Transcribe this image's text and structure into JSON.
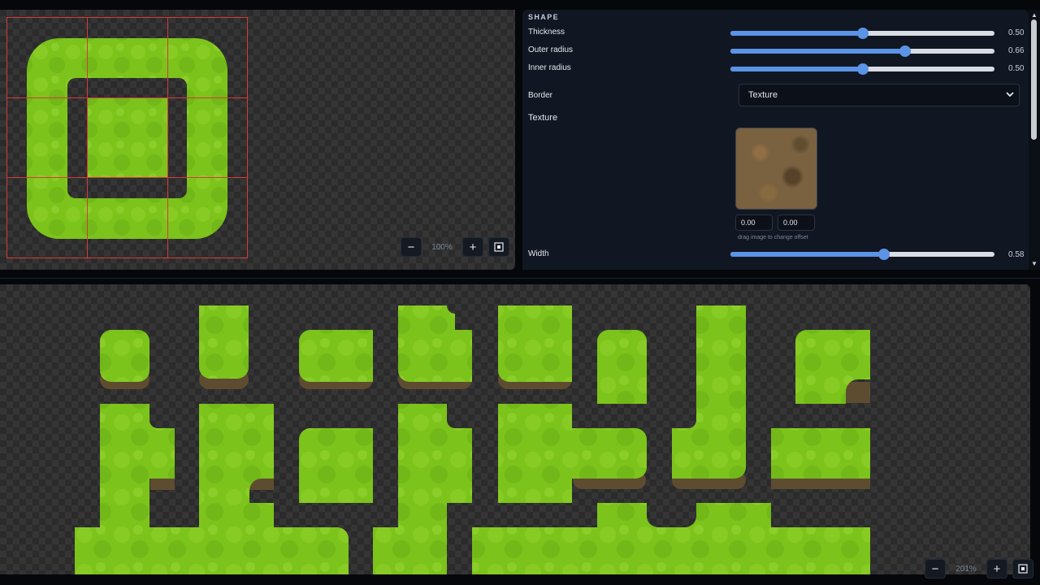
{
  "shape_panel": {
    "section_title": "SHAPE",
    "thickness": {
      "label": "Thickness",
      "value": 0.5,
      "value_text": "0.50"
    },
    "outer_radius": {
      "label": "Outer radius",
      "value": 0.66,
      "value_text": "0.66"
    },
    "inner_radius": {
      "label": "Inner radius",
      "value": 0.5,
      "value_text": "0.50"
    },
    "border": {
      "label": "Border",
      "selected": "Texture"
    },
    "texture": {
      "label": "Texture",
      "offset_x": "0.00",
      "offset_y": "0.00",
      "hint": "drag image to change offset"
    },
    "width": {
      "label": "Width",
      "value": 0.58,
      "value_text": "0.58"
    }
  },
  "top_preview": {
    "zoom": "100%"
  },
  "bottom_preview": {
    "zoom": "201%"
  },
  "icons": {
    "zoom_out": "minus-icon",
    "zoom_in": "plus-icon",
    "fit": "fit-frame-icon",
    "dropdown": "chevron-down-icon"
  },
  "colors": {
    "accent": "#5b93e6",
    "grass": "#7ac21a",
    "dirt": "#6e5a3c",
    "grid_line": "#d63a3a"
  }
}
